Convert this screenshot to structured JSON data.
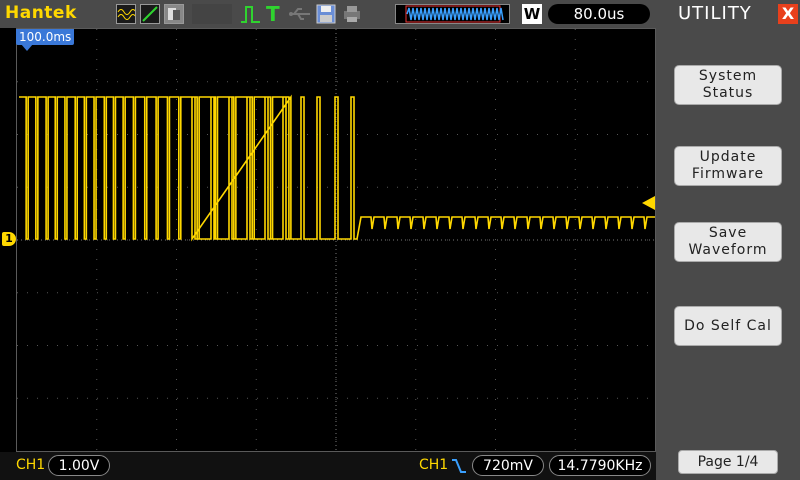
{
  "brand": "Hantek",
  "toolbar": {
    "timebase": "80.0us",
    "window_label": "W",
    "trigger_status": "T",
    "trigger_delay": "100.0ms"
  },
  "menu": {
    "title": "UTILITY",
    "close_label": "X",
    "buttons": [
      {
        "line1": "System",
        "line2": "Status"
      },
      {
        "line1": "Update",
        "line2": "Firmware"
      },
      {
        "line1": "Save",
        "line2": "Waveform"
      },
      {
        "line1": "Do Self Cal",
        "line2": ""
      }
    ],
    "page": "Page 1/4"
  },
  "status": {
    "ch_label": "CH1",
    "volts_div": "1.00V",
    "trig_ch": "CH1",
    "trig_level": "720mV",
    "frequency": "14.7790KHz"
  },
  "channel_marker": "1",
  "colors": {
    "trace": "#ffd800",
    "bar": "#4a4a4a",
    "trigger_marker": "#3a78d8"
  }
}
